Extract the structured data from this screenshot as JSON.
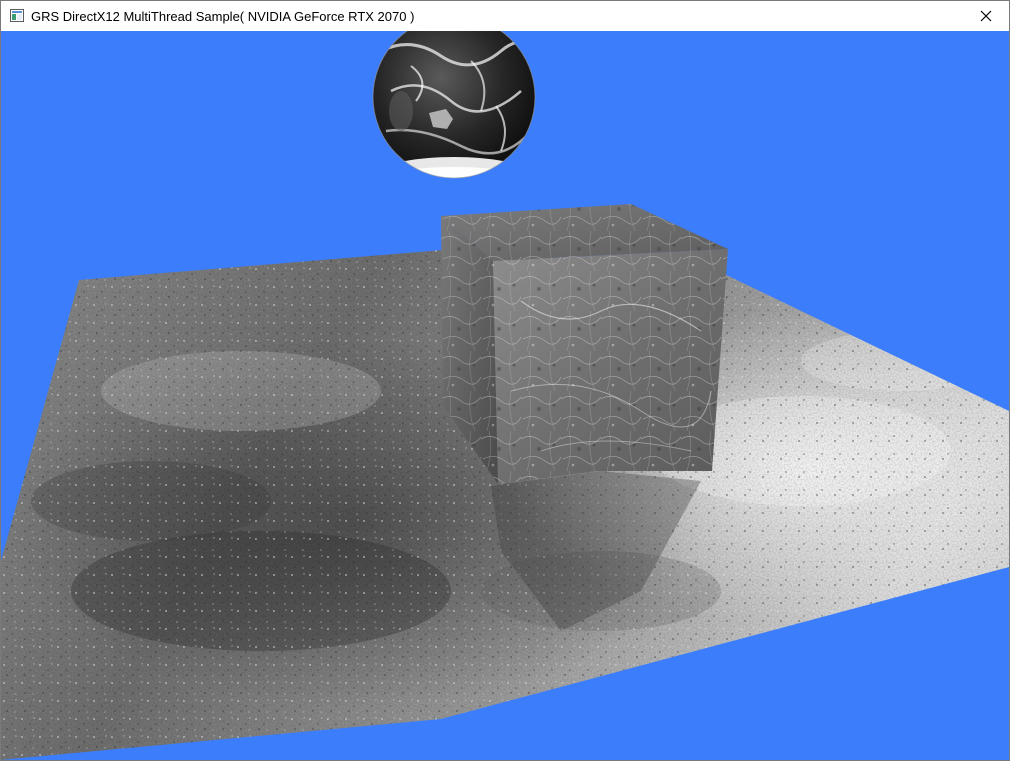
{
  "window": {
    "title": "GRS DirectX12 MultiThread Sample( NVIDIA GeForce RTX 2070 )",
    "app_icon": "window-app-icon",
    "close_icon": "close-icon"
  },
  "scene": {
    "background_color": "#3b7dfb",
    "objects": [
      "globe",
      "ground-plane",
      "marble-cube"
    ]
  }
}
